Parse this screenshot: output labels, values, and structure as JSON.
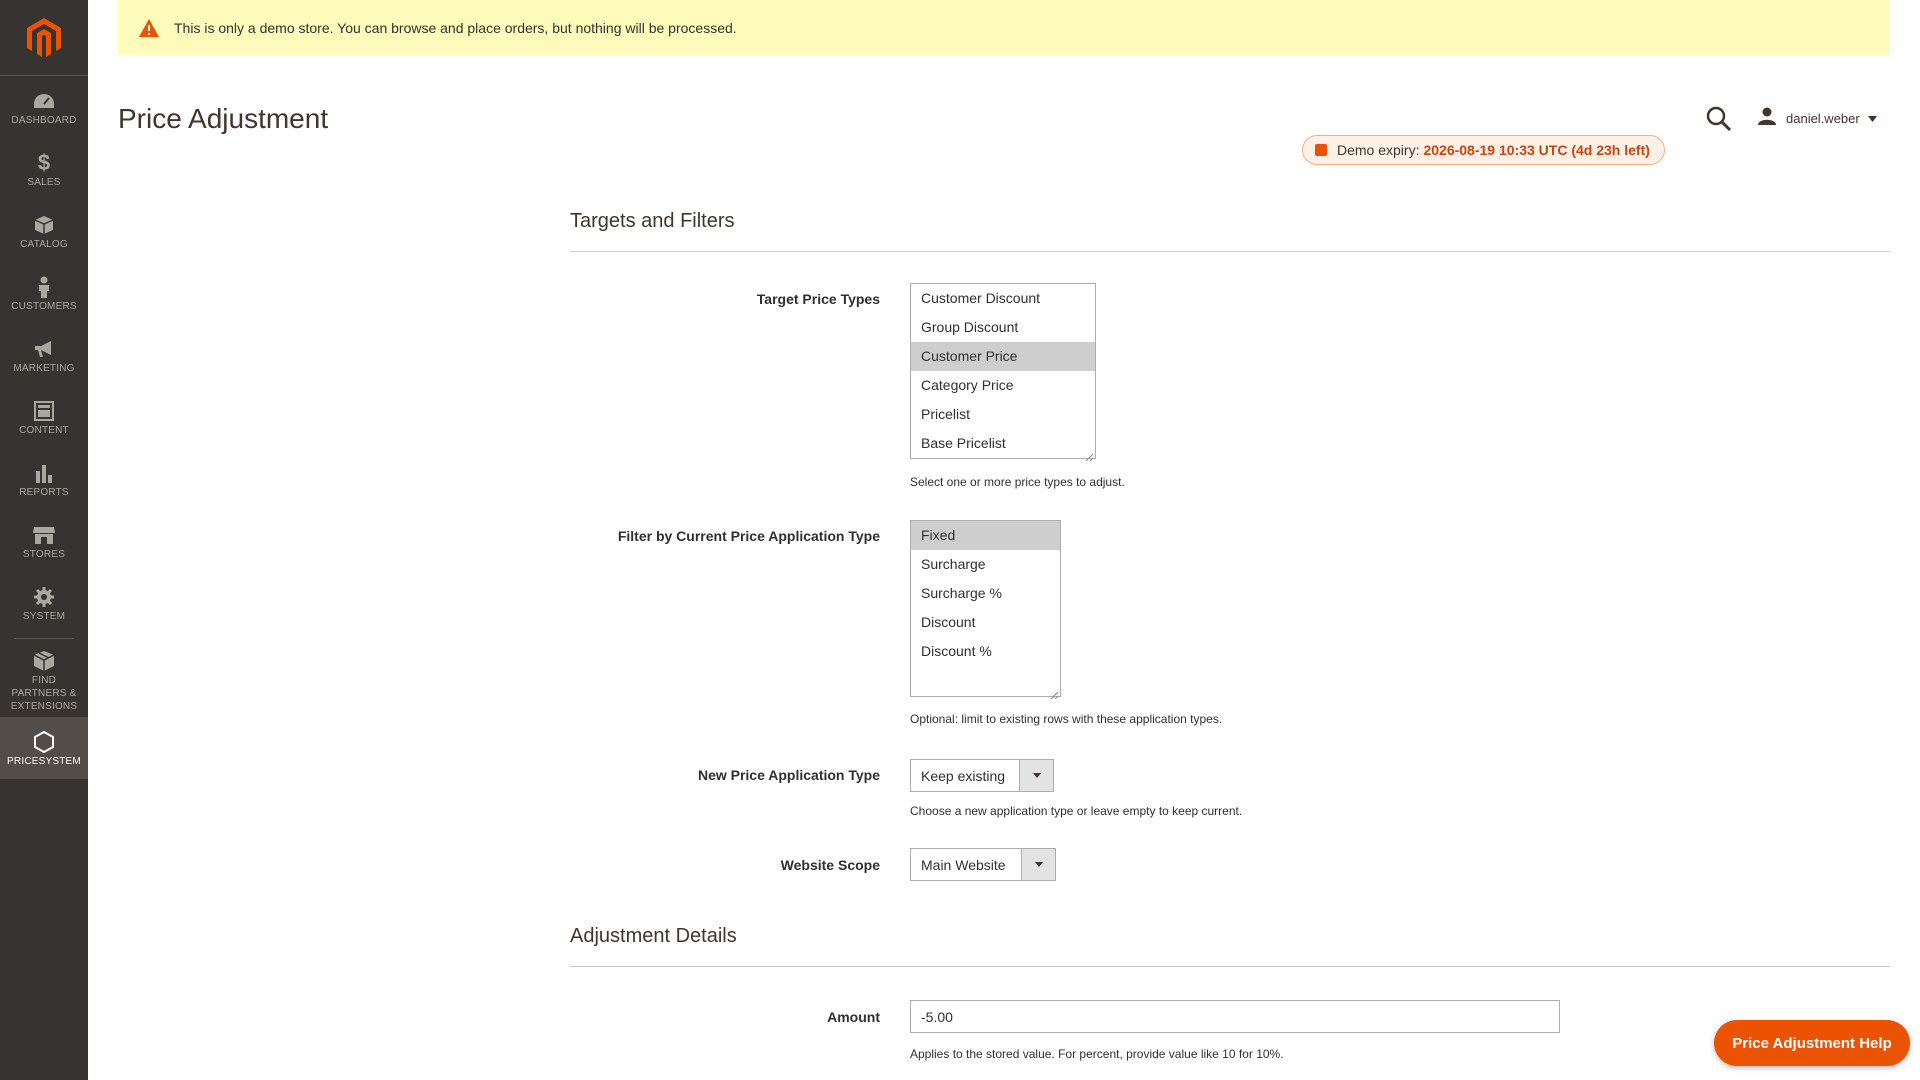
{
  "sidebar": {
    "items": [
      {
        "label": "DASHBOARD",
        "icon": "dashboard-icon"
      },
      {
        "label": "SALES",
        "icon": "dollar-icon"
      },
      {
        "label": "CATALOG",
        "icon": "cube-icon"
      },
      {
        "label": "CUSTOMERS",
        "icon": "person-icon"
      },
      {
        "label": "MARKETING",
        "icon": "megaphone-icon"
      },
      {
        "label": "CONTENT",
        "icon": "layout-icon"
      },
      {
        "label": "REPORTS",
        "icon": "bar-chart-icon"
      },
      {
        "label": "STORES",
        "icon": "store-icon"
      },
      {
        "label": "SYSTEM",
        "icon": "gear-icon"
      },
      {
        "label": "FIND PARTNERS & EXTENSIONS",
        "icon": "box-icon"
      },
      {
        "label": "PRICESYSTEM",
        "icon": "hexagon-icon"
      }
    ]
  },
  "banner": {
    "text": "This is only a demo store. You can browse and place orders, but nothing will be processed."
  },
  "header": {
    "title": "Price Adjustment",
    "username": "daniel.weber",
    "expiry_label": "Demo expiry:",
    "expiry_value": "2026-08-19 10:33 UTC (4d 23h left)"
  },
  "targets": {
    "section_title": "Targets and Filters",
    "target_price_types": {
      "label": "Target Price Types",
      "options": [
        "Customer Discount",
        "Group Discount",
        "Customer Price",
        "Category Price",
        "Pricelist",
        "Base Pricelist"
      ],
      "selected": [
        "Customer Price"
      ],
      "note": "Select one or more price types to adjust."
    },
    "filter_application": {
      "label": "Filter by Current Price Application Type",
      "options": [
        "Fixed",
        "Surcharge",
        "Surcharge %",
        "Discount",
        "Discount %"
      ],
      "selected": [
        "Fixed"
      ],
      "note": "Optional: limit to existing rows with these application types."
    },
    "new_application": {
      "label": "New Price Application Type",
      "value": "Keep existing",
      "note": "Choose a new application type or leave empty to keep current."
    },
    "website_scope": {
      "label": "Website Scope",
      "value": "Main Website"
    }
  },
  "adjustment": {
    "section_title": "Adjustment Details",
    "amount": {
      "label": "Amount",
      "value": "-5.00",
      "note": "Applies to the stored value. For percent, provide value like 10 for 10%."
    }
  },
  "help_button": "Price Adjustment Help",
  "colors": {
    "accent": "#eb5202",
    "sidebar": "#373330",
    "banner": "#fffbbb"
  }
}
